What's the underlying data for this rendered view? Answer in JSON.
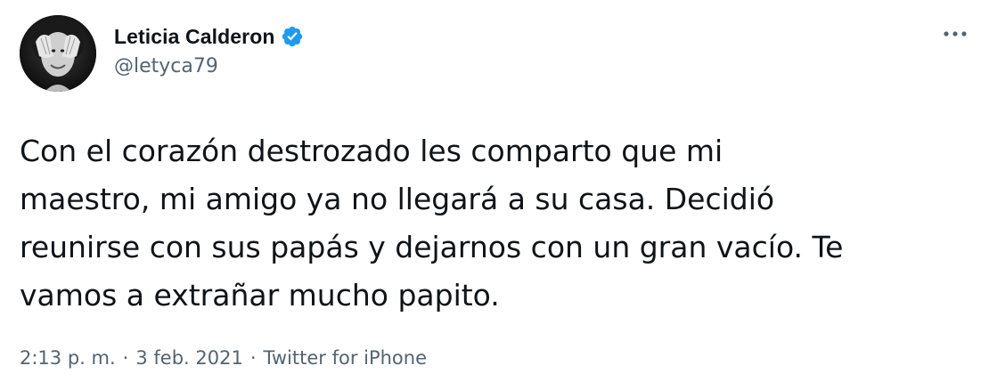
{
  "author": {
    "display_name": "Leticia Calderon",
    "handle": "@letyca79",
    "verified": true,
    "verified_color": "#1d9bf0",
    "avatar_icon": "avatar-photo"
  },
  "more_icon": "more-options-icon",
  "tweet": {
    "text": "Con el corazón destrozado les comparto que mi\nmaestro, mi amigo ya no llegará a su casa. Decidió\nreunirse con sus papás y dejarnos con un gran vacío. Te\nvamos a extrañar mucho papito."
  },
  "meta": {
    "time": "2:13 p. m.",
    "separator": "·",
    "date": "3 feb. 2021",
    "source": "Twitter for iPhone"
  },
  "colors": {
    "text_primary": "#0f1419",
    "text_secondary": "#536471",
    "background": "#ffffff"
  }
}
